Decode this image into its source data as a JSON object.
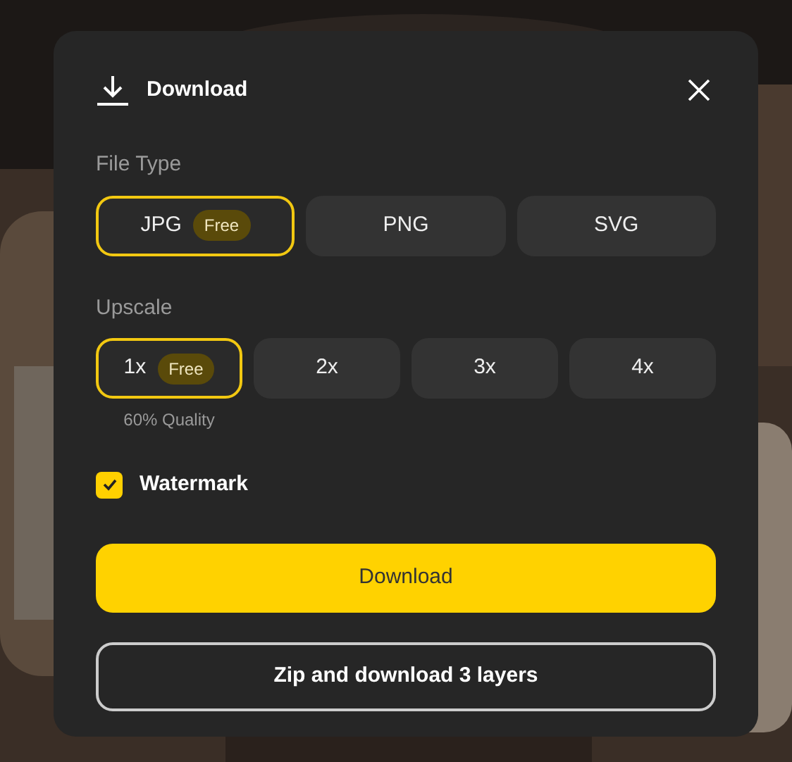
{
  "dialog": {
    "title": "Download",
    "file_type": {
      "label": "File Type",
      "options": [
        {
          "label": "JPG",
          "badge": "Free",
          "selected": true
        },
        {
          "label": "PNG",
          "selected": false
        },
        {
          "label": "SVG",
          "selected": false
        }
      ]
    },
    "upscale": {
      "label": "Upscale",
      "options": [
        {
          "label": "1x",
          "badge": "Free",
          "note": "60% Quality",
          "selected": true
        },
        {
          "label": "2x",
          "selected": false
        },
        {
          "label": "3x",
          "selected": false
        },
        {
          "label": "4x",
          "selected": false
        }
      ]
    },
    "watermark": {
      "label": "Watermark",
      "checked": true
    },
    "primary_button": "Download",
    "secondary_button": "Zip and download 3 layers"
  }
}
